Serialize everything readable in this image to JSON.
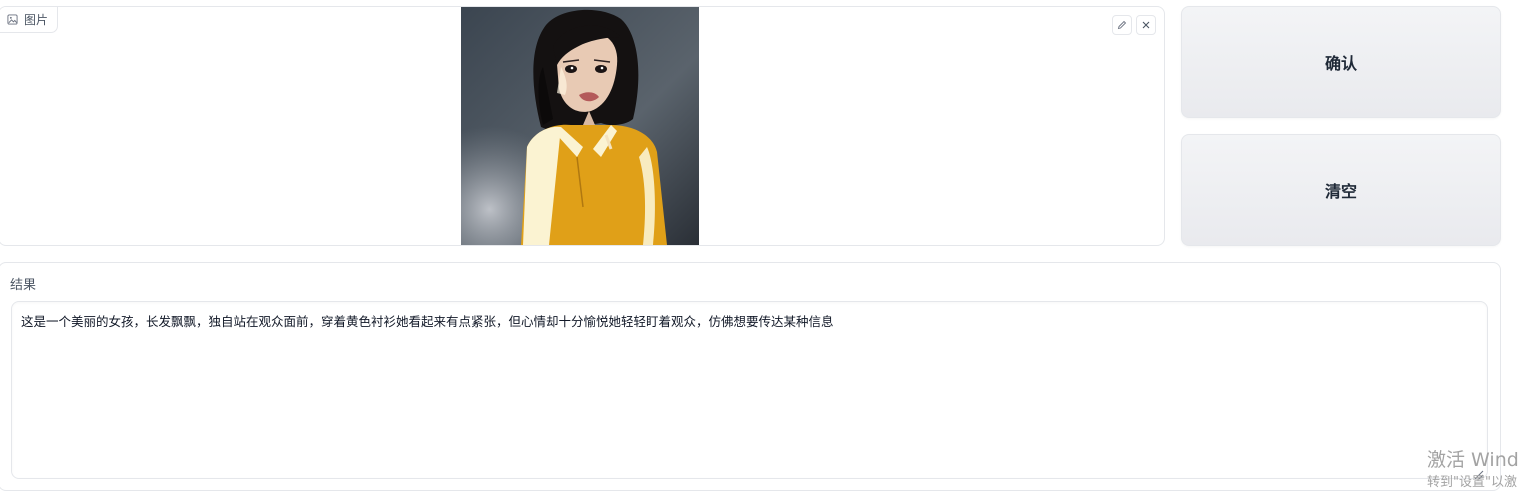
{
  "image_block": {
    "label": "图片",
    "label_icon": "image-icon",
    "edit_icon": "pencil-icon",
    "close_icon": "close-icon"
  },
  "buttons": {
    "confirm": "确认",
    "clear": "清空"
  },
  "result": {
    "label": "结果",
    "text": "这是一个美丽的女孩，长发飘飘，独自站在观众面前，穿着黄色衬衫她看起来有点紧张，但心情却十分愉悦她轻轻盯着观众，仿佛想要传达某种信息"
  },
  "watermark": {
    "line1": "激活 Wind",
    "line2": "转到\"设置\"以激"
  },
  "colors": {
    "border": "#e5e7eb",
    "button_bg": "#eceef2",
    "shirt": "#e0a018",
    "hair": "#1a1616"
  }
}
